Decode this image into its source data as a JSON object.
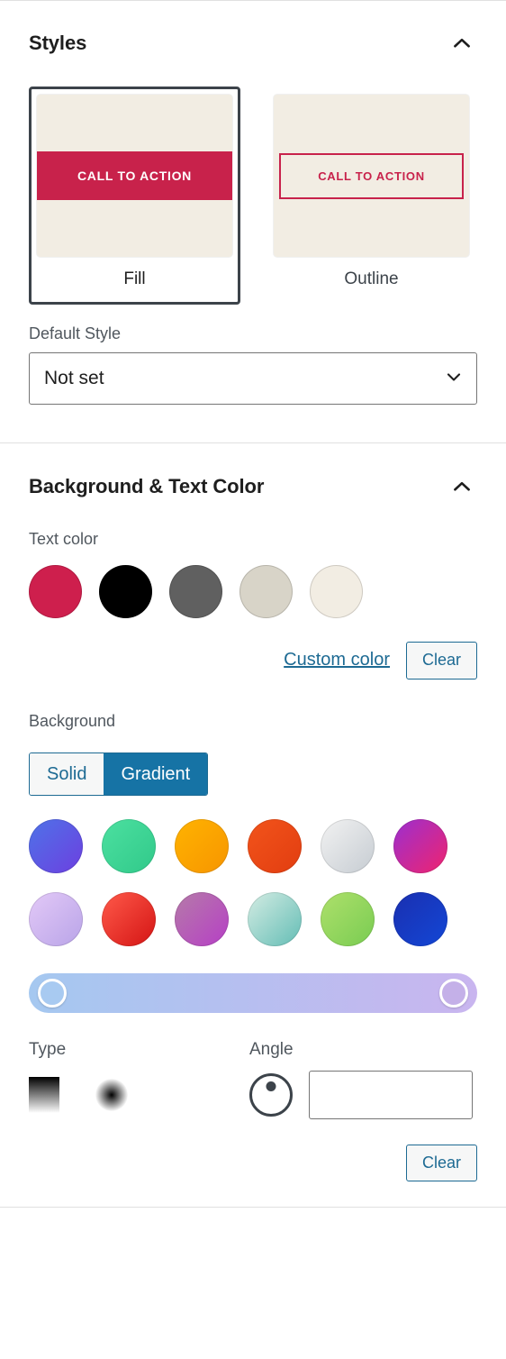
{
  "colors": {
    "accent_red": "#c8224b",
    "cream": "#f2ede3",
    "link_blue": "#1d6a93",
    "toggle_active_blue": "#1673a5",
    "selected_border": "#3c434a"
  },
  "styles_section": {
    "title": "Styles",
    "collapse_icon": "chevron-up-icon",
    "cards": [
      {
        "label": "Fill",
        "cta_text": "CALL TO ACTION",
        "selected": true
      },
      {
        "label": "Outline",
        "cta_text": "CALL TO ACTION",
        "selected": false
      }
    ],
    "default_style": {
      "label": "Default Style",
      "value": "Not set",
      "caret_icon": "chevron-down-icon"
    }
  },
  "bg_text_section": {
    "title": "Background & Text Color",
    "collapse_icon": "chevron-up-icon",
    "text_color": {
      "label": "Text color",
      "swatches": [
        {
          "name": "crimson",
          "hex": "#ce1f4d"
        },
        {
          "name": "black",
          "hex": "#000000"
        },
        {
          "name": "dark-gray",
          "hex": "#606060"
        },
        {
          "name": "warm-gray",
          "hex": "#d8d4c8"
        },
        {
          "name": "off-white",
          "hex": "#f2ede3"
        }
      ],
      "custom_color_label": "Custom color",
      "clear_label": "Clear"
    },
    "background": {
      "label": "Background",
      "tabs": [
        {
          "label": "Solid",
          "active": false
        },
        {
          "label": "Gradient",
          "active": true
        }
      ],
      "gradients": [
        {
          "name": "blue-purple",
          "css": "linear-gradient(135deg, #4e73e8 0%, #6d3fe0 100%)"
        },
        {
          "name": "green-mint",
          "css": "linear-gradient(135deg, #4ce0a0 0%, #31c98a 100%)"
        },
        {
          "name": "orange-amber",
          "css": "linear-gradient(135deg, #ffb300 0%, #f79500 100%)"
        },
        {
          "name": "red-orange",
          "css": "linear-gradient(135deg, #f2541b 0%, #e23d10 100%)"
        },
        {
          "name": "light-gray",
          "css": "linear-gradient(135deg, #f2f2f2 0%, #c6ccd2 100%)"
        },
        {
          "name": "purple-pink",
          "css": "linear-gradient(135deg, #9b2fd0 0%, #f0246e 100%)"
        },
        {
          "name": "lavender",
          "css": "linear-gradient(135deg, #e3c9f7 0%, #b9a4e8 100%)"
        },
        {
          "name": "red-crimson",
          "css": "linear-gradient(135deg, #ff5a4a 0%, #d41414 100%)"
        },
        {
          "name": "mauve-magenta",
          "css": "linear-gradient(135deg, #b57ba8 0%, #b63fc6 100%)"
        },
        {
          "name": "mint-teal",
          "css": "linear-gradient(135deg, #d4ece3 0%, #63bdb5 100%)"
        },
        {
          "name": "lime-green",
          "css": "linear-gradient(135deg, #aee06b 0%, #79cc52 100%)"
        },
        {
          "name": "deep-blue",
          "css": "linear-gradient(135deg, #1a2fb0 0%, #1347d6 100%)"
        }
      ],
      "slider": {
        "gradient_css": "linear-gradient(90deg, #a5c8f0 0%, #c9b5ef 100%)",
        "left_stop_color": "#a8caf1",
        "right_stop_color": "#c4b0e8"
      },
      "type": {
        "label": "Type",
        "options": [
          {
            "name": "linear-gradient-icon"
          },
          {
            "name": "radial-gradient-icon"
          }
        ]
      },
      "angle": {
        "label": "Angle",
        "dial_icon": "angle-dial-icon",
        "value": "",
        "placeholder": ""
      },
      "clear_label": "Clear"
    }
  }
}
